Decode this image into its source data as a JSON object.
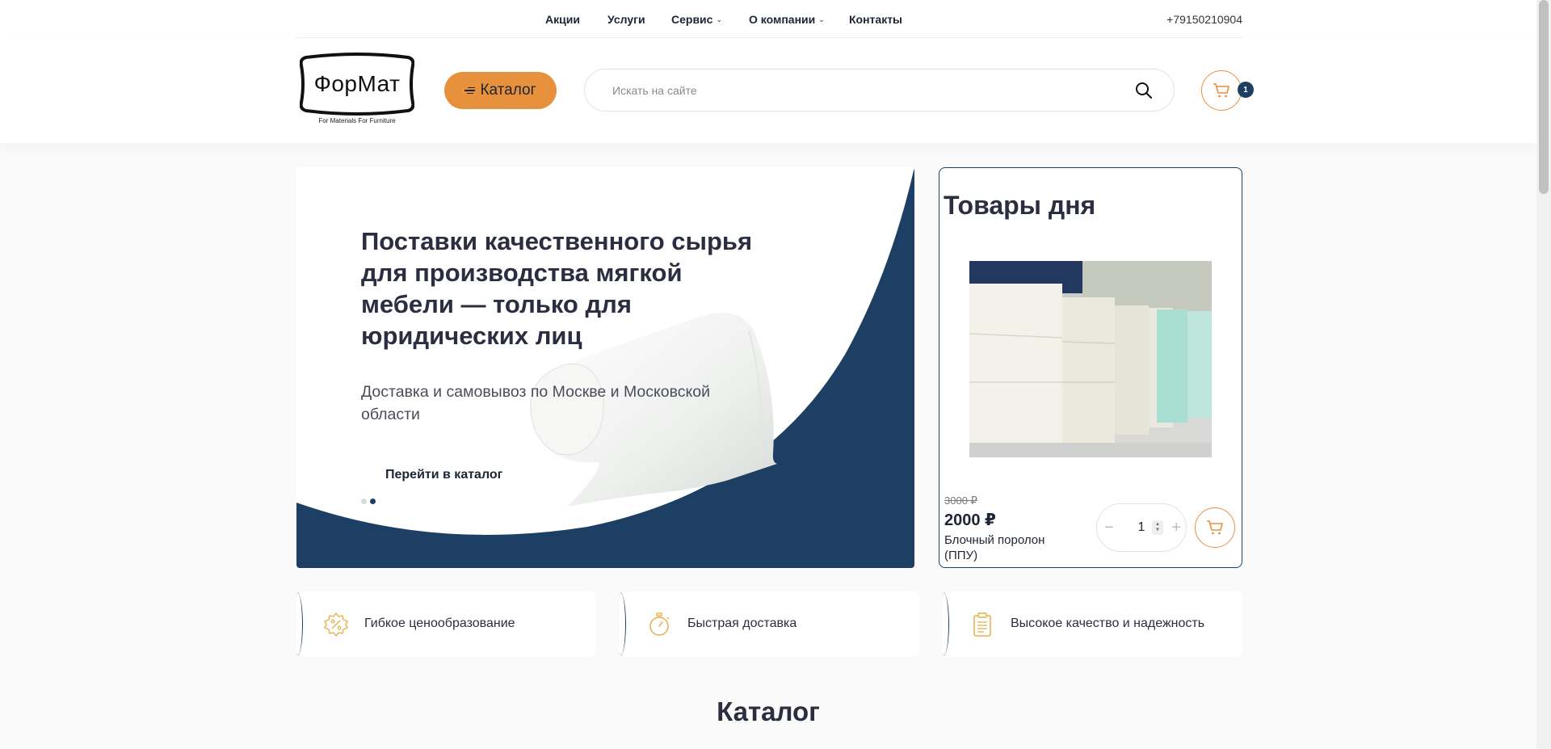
{
  "topnav": {
    "items": [
      {
        "label": "Акции",
        "dropdown": false
      },
      {
        "label": "Услуги",
        "dropdown": false
      },
      {
        "label": "Сервис",
        "dropdown": true
      },
      {
        "label": "О компании",
        "dropdown": true
      },
      {
        "label": "Контакты",
        "dropdown": false
      }
    ],
    "phone": "+79150210904"
  },
  "header": {
    "logo_text": "ФорМат",
    "logo_subtitle": "For Materials For Furniture",
    "catalog_button": "Каталог",
    "search_placeholder": "Искать на сайте",
    "cart_count": "1"
  },
  "hero": {
    "title": "Поставки качественного сырья для производства мягкой мебели — только для юридических лиц",
    "subtitle": "Доставка и самовывоз по Москве и Московской области",
    "button": "Перейти в каталог",
    "slides_total": 2,
    "active_slide": 2
  },
  "deal": {
    "title": "Товары дня",
    "old_price": "3000 ₽",
    "price": "2000 ₽",
    "product_name": "Блочный поролон (ППУ)",
    "quantity": "1"
  },
  "features": [
    {
      "label": "Гибкое ценообразование",
      "icon": "percent-gear-icon"
    },
    {
      "label": "Быстрая доставка",
      "icon": "stopwatch-icon"
    },
    {
      "label": "Высокое качество и надежность",
      "icon": "clipboard-icon"
    }
  ],
  "catalog_section_title": "Каталог",
  "colors": {
    "accent_orange": "#e8913c",
    "brand_navy": "#1c3f63",
    "text_dark": "#2b2e40"
  }
}
